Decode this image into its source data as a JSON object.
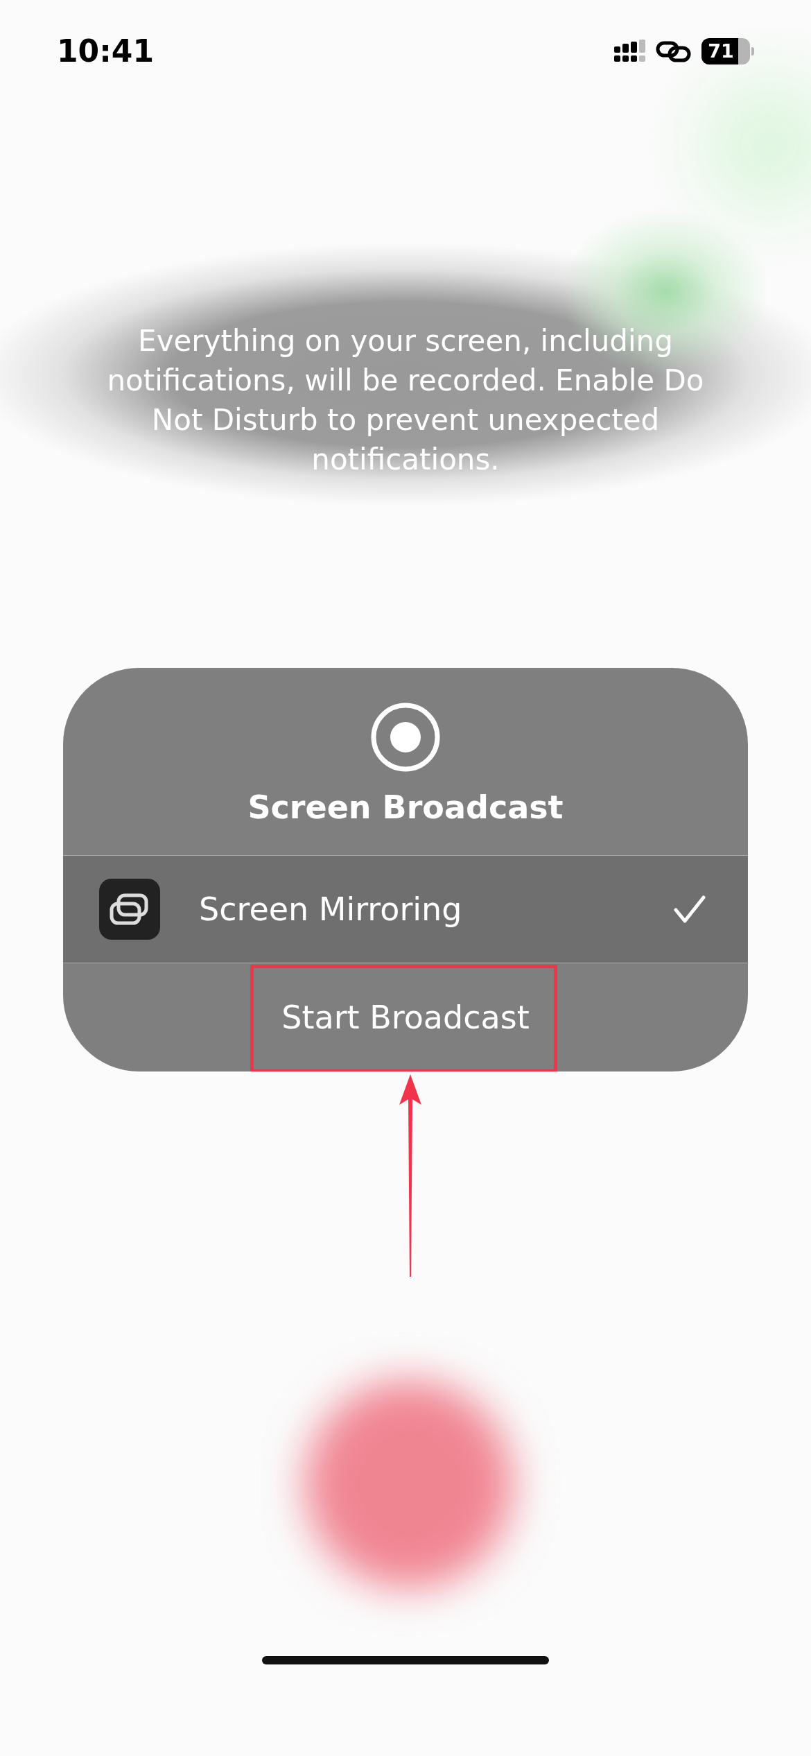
{
  "status_bar": {
    "time": "10:41",
    "battery": "71"
  },
  "message": "Everything on your screen, including notifications, will be recorded. Enable Do Not Disturb to prevent unexpected notifications.",
  "sheet": {
    "title": "Screen Broadcast",
    "options": [
      {
        "label": "Screen Mirroring",
        "checked": true
      }
    ],
    "action": "Start Broadcast"
  }
}
